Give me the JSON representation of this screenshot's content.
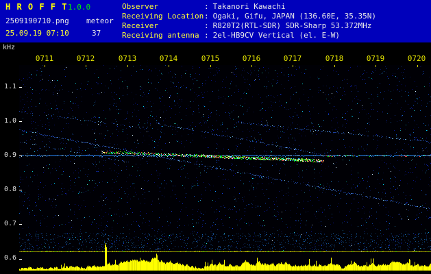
{
  "header": {
    "app_title": "H R O F F T",
    "version": "1.0.0",
    "filename": "2509190710.png",
    "mode": "meteor",
    "datetime": "25.09.19 07:10",
    "count": "37",
    "separator": ":",
    "info_rows": [
      {
        "label": "Observer",
        "value": "Takanori Kawachi"
      },
      {
        "label": "Receiving Location",
        "value": "Ogaki, Gifu, JAPAN (136.60E, 35.35N)"
      },
      {
        "label": "Receiver",
        "value": "R820T2(RTL-SDR) SDR-Sharp 53.372MHz"
      },
      {
        "label": "Receiving antenna",
        "value": "2el-HB9CV Vertical (el. E-W)"
      }
    ]
  },
  "spectrogram": {
    "y_axis_unit": "kHz",
    "y_ticks": [
      "1.1",
      "1.0",
      "0.9",
      "0.8",
      "0.7",
      "0.6"
    ],
    "x_ticks": [
      "0711",
      "0712",
      "0713",
      "0714",
      "0715",
      "0716",
      "0717",
      "0718",
      "0719",
      "0720"
    ]
  },
  "colors": {
    "header_bg": "#0000BB",
    "label_yellow": "#FFFF33",
    "value_white": "#E8E8E8",
    "version_green": "#00EE00",
    "axis_white": "#DDDDDD",
    "tick_yellow": "#CCCC00",
    "signal_bar_yellow": "#FFFF00",
    "signal_bar_dim": "#E6E600",
    "carrier_blue": "#288CFF",
    "carrier_bright": "#9AD8FF",
    "echo_green": "#00E000",
    "echo_red": "#FF5050",
    "echo_cyan": "#30C0FF",
    "echo_white": "#FFFFFF",
    "echo_yellow": "#FFFF60",
    "baseline_olive": "#8A8A00",
    "baseline_green": "#55CC00",
    "baseline_bright": "#CCCC00",
    "plot_bg": "#000005"
  }
}
